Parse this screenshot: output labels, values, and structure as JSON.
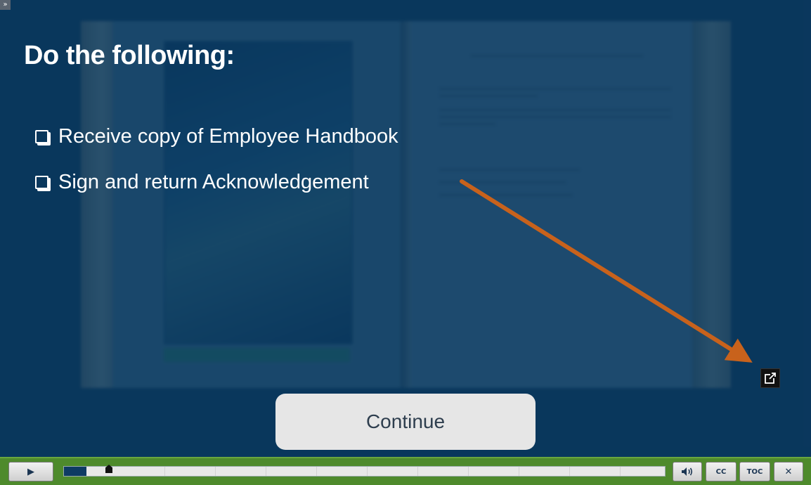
{
  "slide": {
    "title": "Do the following:",
    "checklist": [
      "Receive copy of Employee Handbook",
      "Sign and return Acknowledgement"
    ],
    "continue_label": "Continue",
    "annotation_arrow_color": "#c8621c"
  },
  "player": {
    "menu_toggle_label": "»",
    "play_symbol": "▶",
    "progress": 0.038,
    "volume_symbol": "🔊",
    "cc_label": "CC",
    "toc_label": "TOC",
    "close_label": "✕"
  },
  "colors": {
    "stage_background": "#0c3a60",
    "control_bar": "#4e8a2c",
    "progress_fill": "#0e3b63",
    "button_light": "#e6e6e6"
  }
}
